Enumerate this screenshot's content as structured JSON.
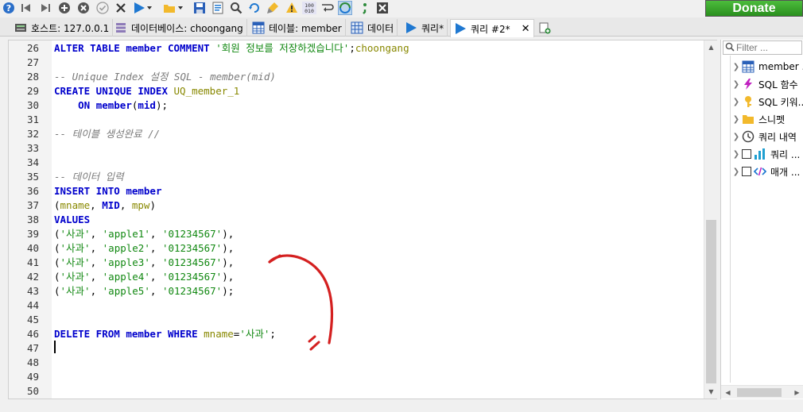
{
  "donate_label": "Donate",
  "tabs": [
    {
      "label": "호스트: 127.0.0.1"
    },
    {
      "label": "데이터베이스: choongang"
    },
    {
      "label": "테이블: member"
    },
    {
      "label": "데이터"
    },
    {
      "label": "쿼리*"
    },
    {
      "label": "쿼리 #2*"
    }
  ],
  "tab_close": "✕",
  "editor": {
    "lines": [
      {
        "n": "26",
        "segs": [
          [
            "kw",
            "ALTER TABLE "
          ],
          [
            "kw",
            "member "
          ],
          [
            "kw",
            "COMMENT "
          ],
          [
            "str",
            "'회원 정보를 저장하겠습니다'"
          ],
          [
            "pl",
            ";"
          ],
          [
            "id",
            "choongang"
          ]
        ]
      },
      {
        "n": "27",
        "segs": []
      },
      {
        "n": "28",
        "segs": [
          [
            "cm",
            "-- Unique Index 설정 SQL - member(mid)"
          ]
        ]
      },
      {
        "n": "29",
        "segs": [
          [
            "kw",
            "CREATE UNIQUE INDEX "
          ],
          [
            "id",
            "UQ_member_1"
          ]
        ]
      },
      {
        "n": "30",
        "segs": [
          [
            "pl",
            "    "
          ],
          [
            "kw",
            "ON "
          ],
          [
            "kw",
            "member"
          ],
          [
            "pl",
            "("
          ],
          [
            "kw",
            "mid"
          ],
          [
            "pl",
            ");"
          ]
        ]
      },
      {
        "n": "31",
        "segs": []
      },
      {
        "n": "32",
        "segs": [
          [
            "cm",
            "-- 테이블 생성완료 //"
          ]
        ]
      },
      {
        "n": "33",
        "segs": []
      },
      {
        "n": "34",
        "segs": []
      },
      {
        "n": "35",
        "segs": [
          [
            "cm",
            "-- 데이터 입력"
          ]
        ]
      },
      {
        "n": "36",
        "segs": [
          [
            "kw",
            "INSERT INTO "
          ],
          [
            "kw",
            "member"
          ]
        ]
      },
      {
        "n": "37",
        "segs": [
          [
            "pl",
            "("
          ],
          [
            "id",
            "mname"
          ],
          [
            "pl",
            ", "
          ],
          [
            "kw",
            "MID"
          ],
          [
            "pl",
            ", "
          ],
          [
            "id",
            "mpw"
          ],
          [
            "pl",
            ")"
          ]
        ]
      },
      {
        "n": "38",
        "segs": [
          [
            "kw",
            "VALUES"
          ]
        ]
      },
      {
        "n": "39",
        "segs": [
          [
            "pl",
            "("
          ],
          [
            "str",
            "'사과'"
          ],
          [
            "pl",
            ", "
          ],
          [
            "str",
            "'apple1'"
          ],
          [
            "pl",
            ", "
          ],
          [
            "str",
            "'01234567'"
          ],
          [
            "pl",
            "),"
          ]
        ]
      },
      {
        "n": "40",
        "segs": [
          [
            "pl",
            "("
          ],
          [
            "str",
            "'사과'"
          ],
          [
            "pl",
            ", "
          ],
          [
            "str",
            "'apple2'"
          ],
          [
            "pl",
            ", "
          ],
          [
            "str",
            "'01234567'"
          ],
          [
            "pl",
            "),"
          ]
        ]
      },
      {
        "n": "41",
        "segs": [
          [
            "pl",
            "("
          ],
          [
            "str",
            "'사과'"
          ],
          [
            "pl",
            ", "
          ],
          [
            "str",
            "'apple3'"
          ],
          [
            "pl",
            ", "
          ],
          [
            "str",
            "'01234567'"
          ],
          [
            "pl",
            "),"
          ]
        ]
      },
      {
        "n": "42",
        "segs": [
          [
            "pl",
            "("
          ],
          [
            "str",
            "'사과'"
          ],
          [
            "pl",
            ", "
          ],
          [
            "str",
            "'apple4'"
          ],
          [
            "pl",
            ", "
          ],
          [
            "str",
            "'01234567'"
          ],
          [
            "pl",
            "),"
          ]
        ]
      },
      {
        "n": "43",
        "segs": [
          [
            "pl",
            "("
          ],
          [
            "str",
            "'사과'"
          ],
          [
            "pl",
            ", "
          ],
          [
            "str",
            "'apple5'"
          ],
          [
            "pl",
            ", "
          ],
          [
            "str",
            "'01234567'"
          ],
          [
            "pl",
            ");"
          ]
        ]
      },
      {
        "n": "44",
        "segs": []
      },
      {
        "n": "45",
        "segs": []
      },
      {
        "n": "46",
        "segs": [
          [
            "kw",
            "DELETE FROM "
          ],
          [
            "kw",
            "member "
          ],
          [
            "kw",
            "WHERE "
          ],
          [
            "id",
            "mname"
          ],
          [
            "pl",
            "="
          ],
          [
            "str",
            "'사과'"
          ],
          [
            "pl",
            ";"
          ]
        ]
      },
      {
        "n": "47",
        "segs": []
      },
      {
        "n": "48",
        "segs": []
      },
      {
        "n": "49",
        "segs": []
      },
      {
        "n": "50",
        "segs": []
      }
    ]
  },
  "right_panel": {
    "filter_placeholder": "Filter ...",
    "items": [
      {
        "label": "member ...",
        "icon": "table-icon",
        "checkbox": false
      },
      {
        "label": "SQL 함수",
        "icon": "lightning-icon",
        "checkbox": false
      },
      {
        "label": "SQL 키워...",
        "icon": "key-icon",
        "checkbox": false
      },
      {
        "label": "스니펫",
        "icon": "folder-icon",
        "checkbox": false
      },
      {
        "label": "쿼리 내역",
        "icon": "clock-icon",
        "checkbox": false
      },
      {
        "label": "쿼리 ...",
        "icon": "bar-chart-icon",
        "checkbox": true
      },
      {
        "label": "매개 ...",
        "icon": "code-icon",
        "checkbox": true
      }
    ]
  },
  "colors": {
    "annotation": "#d42020",
    "keyword": "#0000cc",
    "string": "#118811",
    "comment": "#7a7a7a"
  }
}
